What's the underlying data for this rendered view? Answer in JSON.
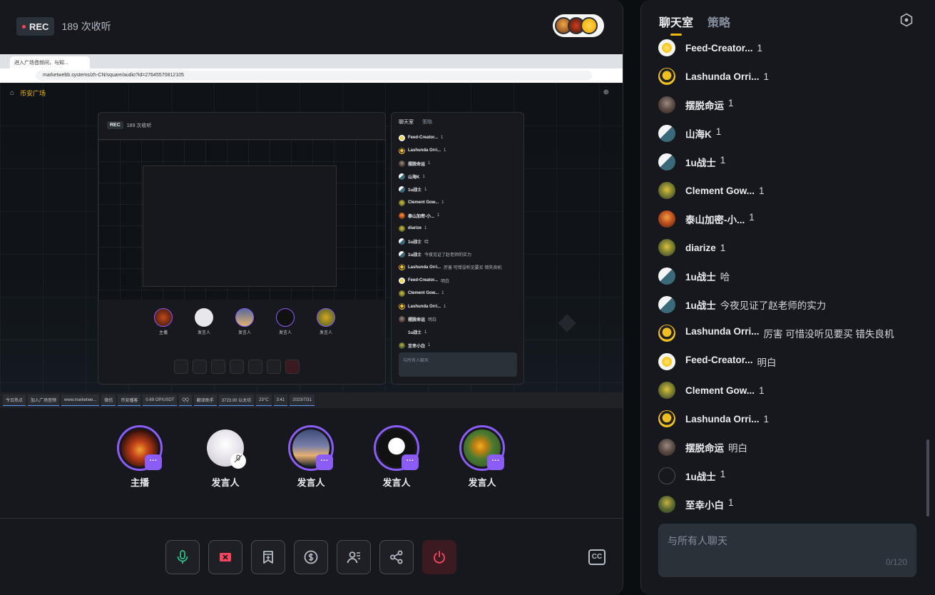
{
  "header": {
    "rec_label": "REC",
    "listeners": "189 次收听"
  },
  "share": {
    "browser_tab_title": "进入广场音频间，与知...",
    "address": "marketwebb.systems/zh-CN/square/audio?id=27645570812105",
    "nav_brand": "币安广场",
    "mini_rec": "REC",
    "mini_listeners": "189 次收听",
    "mini_chat_tab_active": "聊天室",
    "mini_chat_tab_inactive": "策略",
    "mini_input_placeholder": "与所有人聊天",
    "mini_input_count": "0/120",
    "mini_speakers": [
      "主播",
      "发言人",
      "发言人",
      "发言人",
      "发言人"
    ],
    "mini_messages": [
      {
        "name": "Feed-Creator...",
        "text": "1"
      },
      {
        "name": "Lashunda Orri...",
        "text": "1"
      },
      {
        "name": "摆脱命运",
        "text": "1"
      },
      {
        "name": "山海K",
        "text": "1"
      },
      {
        "name": "1u战士",
        "text": "1"
      },
      {
        "name": "Clement Gow...",
        "text": "1"
      },
      {
        "name": "泰山加密-小...",
        "text": "1"
      },
      {
        "name": "diarize",
        "text": "1"
      },
      {
        "name": "1u战士",
        "text": "哈"
      },
      {
        "name": "1u战士",
        "text": "今夜见证了赵老师的实力"
      },
      {
        "name": "Lashunda Orri...",
        "text": "厉害 可惜没听见要买 错失良机"
      },
      {
        "name": "Feed-Creator...",
        "text": "明白"
      },
      {
        "name": "Clement Gow...",
        "text": "1"
      },
      {
        "name": "Lashunda Orri...",
        "text": "1"
      },
      {
        "name": "摆脱命运",
        "text": "明白"
      },
      {
        "name": "1u战士",
        "text": "1"
      },
      {
        "name": "至幸小白",
        "text": "1"
      }
    ],
    "taskbar": [
      "今日热点",
      "加入广场音频",
      "www.marketwe...",
      "微信",
      "币安播客",
      "0.69 OP/USDT",
      "QQ",
      "翻译助手",
      "3723.00 以太坊",
      "23°C",
      "3:41",
      "2023/7/31"
    ]
  },
  "speakers": [
    {
      "label": "主播",
      "has_badge": true
    },
    {
      "label": "发言人",
      "muted": true
    },
    {
      "label": "发言人",
      "has_badge": true
    },
    {
      "label": "发言人",
      "has_badge": true
    },
    {
      "label": "发言人",
      "has_badge": true
    }
  ],
  "controls": [
    "mic-icon",
    "close-icon",
    "bookmark-icon",
    "dollar-icon",
    "users-icon",
    "share-icon",
    "power-icon"
  ],
  "cc_label": "CC",
  "chat": {
    "tab_active": "聊天室",
    "tab_inactive": "策略",
    "placeholder": "与所有人聊天",
    "count": "0/120",
    "messages": [
      {
        "name": "Feed-Creator...",
        "text": "1"
      },
      {
        "name": "Lashunda Orri...",
        "text": "1"
      },
      {
        "name": "摆脱命运",
        "text": "1"
      },
      {
        "name": "山海K",
        "text": "1"
      },
      {
        "name": "1u战士",
        "text": "1"
      },
      {
        "name": "Clement Gow...",
        "text": "1"
      },
      {
        "name": "泰山加密-小...",
        "text": "1"
      },
      {
        "name": "diarize",
        "text": "1"
      },
      {
        "name": "1u战士",
        "text": "哈"
      },
      {
        "name": "1u战士",
        "text": "今夜见证了赵老师的实力"
      },
      {
        "name": "Lashunda Orri...",
        "text": "厉害 可惜没听见要买 错失良机"
      },
      {
        "name": "Feed-Creator...",
        "text": "明白"
      },
      {
        "name": "Clement Gow...",
        "text": "1"
      },
      {
        "name": "Lashunda Orri...",
        "text": "1"
      },
      {
        "name": "摆脱命运",
        "text": "明白"
      },
      {
        "name": "1u战士",
        "text": "1"
      },
      {
        "name": "至幸小白",
        "text": "1"
      }
    ]
  },
  "colors": {
    "accent": "#f0b90b",
    "speaker_ring": "#8b5cf6",
    "danger": "#f6465d",
    "mic": "#2ebd85"
  }
}
